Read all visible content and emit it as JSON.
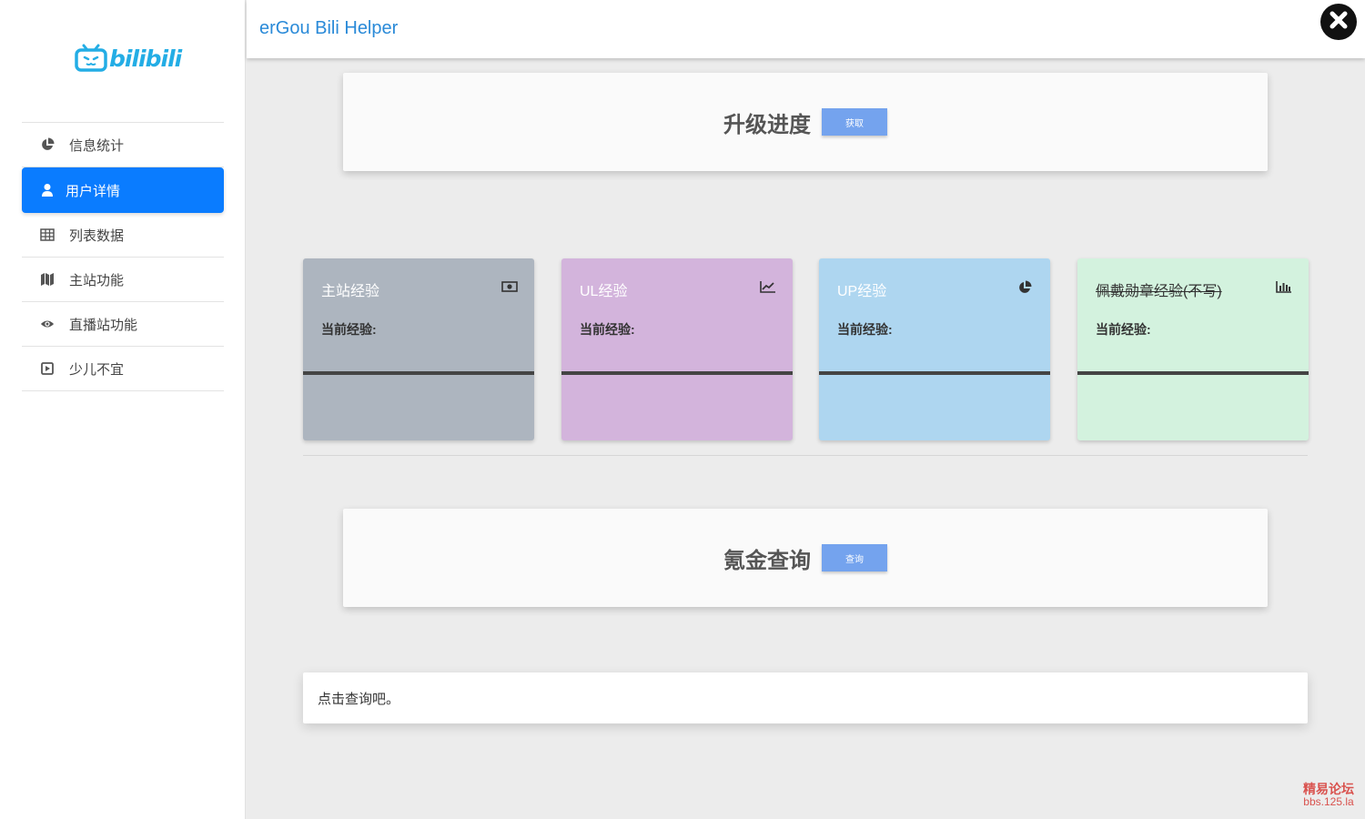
{
  "app": {
    "title": "erGou Bili Helper",
    "logo_text": "bilibili"
  },
  "sidebar": {
    "items": [
      {
        "label": "信息统计",
        "icon": "pie-chart-icon",
        "active": false
      },
      {
        "label": "用户详情",
        "icon": "user-icon",
        "active": true
      },
      {
        "label": "列表数据",
        "icon": "table-icon",
        "active": false
      },
      {
        "label": "主站功能",
        "icon": "map-icon",
        "active": false
      },
      {
        "label": "直播站功能",
        "icon": "eye-icon",
        "active": false
      },
      {
        "label": "少儿不宜",
        "icon": "play-square-icon",
        "active": false
      }
    ]
  },
  "upgrade": {
    "title": "升级进度",
    "button": "获取"
  },
  "cards": [
    {
      "title": "主站经验",
      "label": "当前经验:",
      "icon": "money-icon",
      "color": "#adb5bf",
      "strike": false
    },
    {
      "title": "UL经验",
      "label": "当前经验:",
      "icon": "line-chart-icon",
      "color": "#d3b4dc",
      "strike": false
    },
    {
      "title": "UP经验",
      "label": "当前经验:",
      "icon": "pie-chart-icon",
      "color": "#aed6f0",
      "strike": false
    },
    {
      "title": "佩戴勋章经验(不写)",
      "label": "当前经验:",
      "icon": "bar-chart-icon",
      "color": "#d3f2de",
      "strike": true
    }
  ],
  "query": {
    "title": "氪金查询",
    "button": "查询"
  },
  "result": {
    "text": "点击查询吧。"
  },
  "watermark": {
    "line1": "精易论坛",
    "line2": "bbs.125.la"
  },
  "colors": {
    "accent": "#0a7cff",
    "header_title": "#2a8ad8",
    "button": "#74a3ee",
    "logo": "#23ade5"
  }
}
